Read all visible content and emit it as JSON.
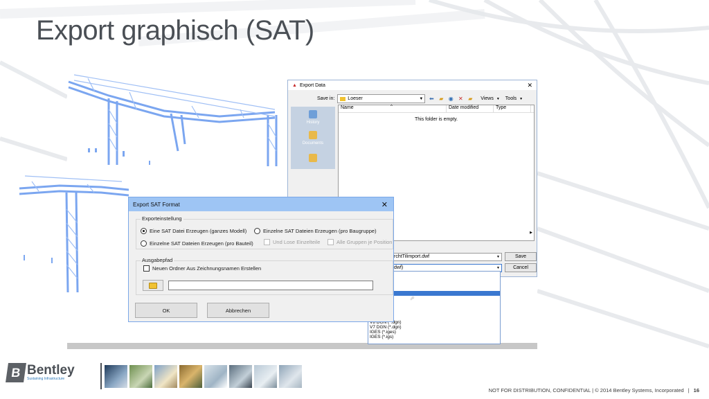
{
  "slide": {
    "title": "Export graphisch (SAT)",
    "footer_note": "NOT FOR DISTRIBUTION, CONFIDENTIAL  |  © 2014 Bentley Systems, Incorporated",
    "separator": "|",
    "page_number": "16"
  },
  "logo": {
    "name": "Bentley",
    "tagline": "Sustaining Infrastructure"
  },
  "export_data_dialog": {
    "title": "Export Data",
    "close": "✕",
    "save_in_label": "Save in:",
    "save_in_value": "Loeser",
    "views_label": "Views",
    "tools_label": "Tools",
    "places": [
      {
        "label": "History"
      },
      {
        "label": "Documents"
      },
      {
        "label": ""
      }
    ],
    "columns": [
      "Name",
      "Date modified",
      "Type"
    ],
    "empty_message": "This folder is empty.",
    "filename_value": "rchtTilimport.dwf",
    "filetype_value": "dwf)",
    "save_button": "Save",
    "cancel_button": "Cancel",
    "filetype_options": [
      "dwf)",
      "dwfx)",
      "",
      "d)",
      "",
      ".stl)",
      "l PS (*.eps)",
      "* dxx)",
      "g)",
      "",
      "V8 DGN (*.dgn)",
      "V7 DGN (*.dgn)",
      "IGES (*.iges)",
      "IGES (*.igs)"
    ]
  },
  "sat_dialog": {
    "title": "Export SAT Format",
    "close": "✕",
    "group_export_label": "Exporteinstellung",
    "option_single": "Eine SAT Datei Erzeugen (ganzes Modell)",
    "option_per_part": "Einzelne SAT Dateien Erzeugen (pro Bauteil)",
    "option_per_group": "Einzelne SAT Dateien Erzeugen (pro Baugruppe)",
    "check_loose_parts": "Und Lose Einzelteile",
    "check_all_groups": "Alle Gruppen je Position",
    "group_output_label": "Ausgabepfad",
    "check_new_folder": "Neuen Ordner Aus Zeichnungsnamen Erstellen",
    "path_value": "",
    "ok_button": "OK",
    "cancel_button": "Abbrechen"
  },
  "colors": {
    "title_text": "#4a4f55",
    "sat_titlebar": "#9ec5f4",
    "model_blue": "#7ba6f0",
    "selection": "#3a78d0"
  }
}
